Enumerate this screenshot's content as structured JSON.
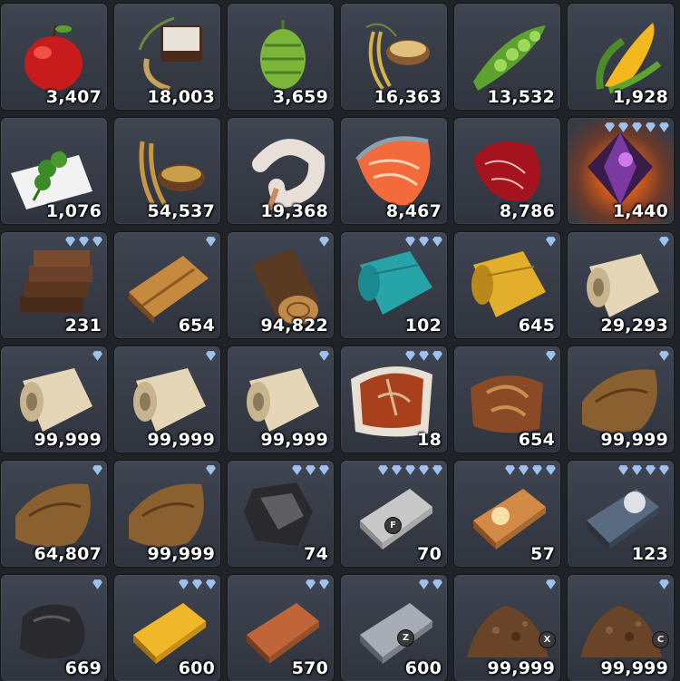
{
  "inventory": {
    "items": [
      {
        "name": "apple",
        "icon": "apple-icon",
        "quantity": "3,407",
        "tier": 0,
        "hotkey": ""
      },
      {
        "name": "flour-grain",
        "icon": "grain-sack-icon",
        "quantity": "18,003",
        "tier": 0,
        "hotkey": ""
      },
      {
        "name": "hops",
        "icon": "hops-icon",
        "quantity": "3,659",
        "tier": 0,
        "hotkey": ""
      },
      {
        "name": "rice",
        "icon": "rice-bowl-icon",
        "quantity": "16,363",
        "tier": 0,
        "hotkey": ""
      },
      {
        "name": "peas",
        "icon": "pea-pod-icon",
        "quantity": "13,532",
        "tier": 0,
        "hotkey": ""
      },
      {
        "name": "corn",
        "icon": "corn-icon",
        "quantity": "1,928",
        "tier": 0,
        "hotkey": ""
      },
      {
        "name": "herbs",
        "icon": "herb-icon",
        "quantity": "1,076",
        "tier": 0,
        "hotkey": ""
      },
      {
        "name": "wheat",
        "icon": "wheat-bowl-icon",
        "quantity": "54,537",
        "tier": 0,
        "hotkey": ""
      },
      {
        "name": "shrimp",
        "icon": "shrimp-icon",
        "quantity": "19,368",
        "tier": 0,
        "hotkey": ""
      },
      {
        "name": "salmon-steak",
        "icon": "fish-steak-icon",
        "quantity": "8,467",
        "tier": 0,
        "hotkey": ""
      },
      {
        "name": "red-meat",
        "icon": "meat-icon",
        "quantity": "8,786",
        "tier": 0,
        "hotkey": ""
      },
      {
        "name": "purple-crystal",
        "icon": "crystal-icon",
        "quantity": "1,440",
        "tier": 5,
        "hotkey": "",
        "glow": true
      },
      {
        "name": "planks-stack",
        "icon": "planks-stack-icon",
        "quantity": "231",
        "tier": 3,
        "hotkey": ""
      },
      {
        "name": "planks",
        "icon": "planks-icon",
        "quantity": "654",
        "tier": 1,
        "hotkey": ""
      },
      {
        "name": "log",
        "icon": "log-icon",
        "quantity": "94,822",
        "tier": 1,
        "hotkey": ""
      },
      {
        "name": "teal-cloth",
        "icon": "cloth-roll-icon",
        "quantity": "102",
        "tier": 3,
        "hotkey": ""
      },
      {
        "name": "gold-cloth",
        "icon": "cloth-roll-icon",
        "quantity": "645",
        "tier": 1,
        "hotkey": ""
      },
      {
        "name": "linen",
        "icon": "cloth-roll-icon",
        "quantity": "29,293",
        "tier": 1,
        "hotkey": ""
      },
      {
        "name": "linen",
        "icon": "cloth-roll-icon",
        "quantity": "99,999",
        "tier": 1,
        "hotkey": ""
      },
      {
        "name": "linen",
        "icon": "cloth-roll-icon",
        "quantity": "99,999",
        "tier": 1,
        "hotkey": ""
      },
      {
        "name": "linen",
        "icon": "cloth-roll-icon",
        "quantity": "99,999",
        "tier": 1,
        "hotkey": ""
      },
      {
        "name": "fur-leather",
        "icon": "leather-bundle-icon",
        "quantity": "18",
        "tier": 3,
        "hotkey": ""
      },
      {
        "name": "leather",
        "icon": "leather-bundle-icon",
        "quantity": "654",
        "tier": 1,
        "hotkey": ""
      },
      {
        "name": "hide",
        "icon": "hide-icon",
        "quantity": "99,999",
        "tier": 1,
        "hotkey": ""
      },
      {
        "name": "hide",
        "icon": "hide-icon",
        "quantity": "64,807",
        "tier": 1,
        "hotkey": ""
      },
      {
        "name": "hide",
        "icon": "hide-icon",
        "quantity": "99,999",
        "tier": 1,
        "hotkey": ""
      },
      {
        "name": "coal",
        "icon": "coal-icon",
        "quantity": "74",
        "tier": 3,
        "hotkey": ""
      },
      {
        "name": "silver-ingot",
        "icon": "ingot-icon",
        "quantity": "70",
        "tier": 5,
        "hotkey": "F"
      },
      {
        "name": "bronze-ingot",
        "icon": "ingot-icon",
        "quantity": "57",
        "tier": 4,
        "hotkey": ""
      },
      {
        "name": "steel-ingot",
        "icon": "ingot-icon",
        "quantity": "123",
        "tier": 4,
        "hotkey": ""
      },
      {
        "name": "coal-ore",
        "icon": "ore-icon",
        "quantity": "669",
        "tier": 1,
        "hotkey": ""
      },
      {
        "name": "gold-ingot",
        "icon": "ingot-icon",
        "quantity": "600",
        "tier": 3,
        "hotkey": ""
      },
      {
        "name": "copper-ingot",
        "icon": "ingot-icon",
        "quantity": "570",
        "tier": 2,
        "hotkey": ""
      },
      {
        "name": "iron-ingot",
        "icon": "ingot-icon",
        "quantity": "600",
        "tier": 2,
        "hotkey": "Z"
      },
      {
        "name": "dirt",
        "icon": "dirt-pile-icon",
        "quantity": "99,999",
        "tier": 1,
        "hotkey": "X"
      },
      {
        "name": "dirt",
        "icon": "dirt-pile-icon",
        "quantity": "99,999",
        "tier": 1,
        "hotkey": "C"
      }
    ]
  },
  "colors": {
    "slot_bg": "#3a3f4a",
    "gem": "#9ec2ee",
    "text": "#ffffff"
  }
}
